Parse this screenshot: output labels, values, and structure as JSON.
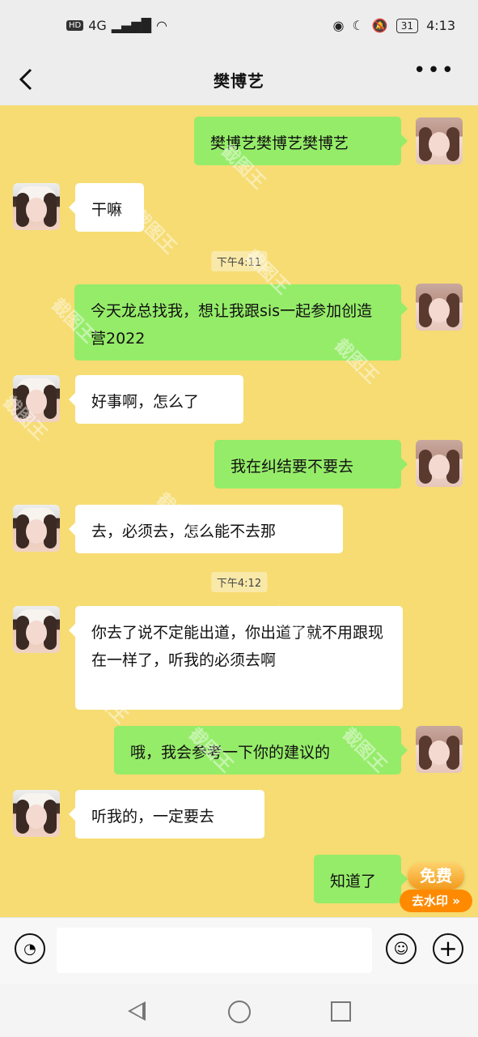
{
  "status_bar": {
    "network": "HD",
    "signal_label": "4G",
    "battery": "31",
    "time": "4:13"
  },
  "header": {
    "title": "樊博艺"
  },
  "messages": [
    {
      "side": "right",
      "text": "樊博艺樊博艺樊博艺"
    },
    {
      "side": "left",
      "text": "干嘛"
    },
    {
      "side": "time",
      "text": "下午4:11"
    },
    {
      "side": "right",
      "text": "今天龙总找我，想让我跟sis一起参加创造营2022"
    },
    {
      "side": "left",
      "text": "好事啊，怎么了"
    },
    {
      "side": "right",
      "text": "我在纠结要不要去"
    },
    {
      "side": "left",
      "text": "去，必须去，怎么能不去那"
    },
    {
      "side": "time",
      "text": "下午4:12"
    },
    {
      "side": "left",
      "text": "你去了说不定能出道，你出道了就不用跟现在一样了，听我的必须去啊"
    },
    {
      "side": "right",
      "text": "哦，我会参考一下你的建议的"
    },
    {
      "side": "left",
      "text": "听我的，一定要去"
    },
    {
      "side": "right",
      "text": "知道了"
    }
  ],
  "input": {
    "placeholder": ""
  },
  "promo": {
    "free": "免费",
    "remove_watermark": "去水印 »"
  },
  "watermark_text": "截图王",
  "icons": {
    "back": "chevron-left-icon",
    "more": "more-icon",
    "voice": "voice-icon",
    "emoji": "emoji-icon",
    "plus": "plus-icon"
  }
}
